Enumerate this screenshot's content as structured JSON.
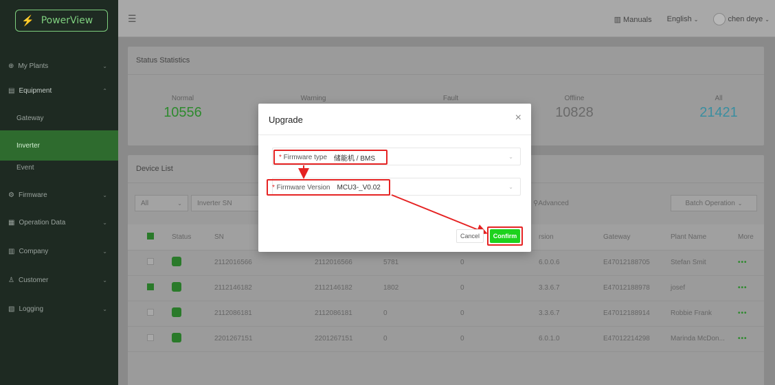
{
  "brand": {
    "logo_text": "PowerView"
  },
  "sidebar": {
    "items": [
      {
        "label": "My Plants",
        "icon": "globe-icon"
      },
      {
        "label": "Equipment",
        "icon": "equipment-icon"
      },
      {
        "label": "Gateway"
      },
      {
        "label": "Inverter",
        "active": true
      },
      {
        "label": "Event"
      },
      {
        "label": "Firmware",
        "icon": "gear-icon"
      },
      {
        "label": "Operation Data",
        "icon": "grid-icon"
      },
      {
        "label": "Company",
        "icon": "company-icon"
      },
      {
        "label": "Customer",
        "icon": "customer-icon"
      },
      {
        "label": "Logging",
        "icon": "log-icon"
      }
    ]
  },
  "header": {
    "manuals": "Manuals",
    "language": "English",
    "user": "chen deye"
  },
  "status": {
    "title": "Status Statistics",
    "items": [
      {
        "label": "Normal",
        "value": "10556",
        "color": "#2e8a2e"
      },
      {
        "label": "Warning",
        "value": ""
      },
      {
        "label": "Fault",
        "value": ""
      },
      {
        "label": "Offline",
        "value": "10828",
        "color": "#6a6a6a"
      },
      {
        "label": "All",
        "value": "21421",
        "color": "#3a8ea0"
      }
    ]
  },
  "device_list": {
    "title": "Device List",
    "filter_all": "All",
    "sn_placeholder": "Inverter SN",
    "advanced": "Advanced",
    "batch": "Batch Operation",
    "columns": [
      "Status",
      "SN",
      "",
      "",
      "",
      "rsion",
      "Gateway",
      "Plant Name",
      "More"
    ],
    "rows": [
      {
        "checked": false,
        "sn": "2112016566",
        "sn2": "2112016566",
        "c3": "5781",
        "c4": "0",
        "version": "6.0.0.6",
        "gateway": "E47012188705",
        "plant": "Stefan Smit"
      },
      {
        "checked": true,
        "sn": "2112146182",
        "sn2": "2112146182",
        "c3": "1802",
        "c4": "0",
        "version": "3.3.6.7",
        "gateway": "E47012188978",
        "plant": "josef"
      },
      {
        "checked": false,
        "sn": "2112086181",
        "sn2": "2112086181",
        "c3": "0",
        "c4": "0",
        "version": "3.3.6.7",
        "gateway": "E47012188914",
        "plant": "Robbie Frank"
      },
      {
        "checked": false,
        "sn": "2201267151",
        "sn2": "2201267151",
        "c3": "0",
        "c4": "0",
        "version": "6.0.1.0",
        "gateway": "E47012214298",
        "plant": "Marinda McDon..."
      }
    ]
  },
  "modal": {
    "title": "Upgrade",
    "firmware_type_label": "Firmware type",
    "firmware_type_value": "储能机 / BMS",
    "firmware_version_label": "Firmware Version",
    "firmware_version_value": "MCU3-_V0.02",
    "cancel": "Cancel",
    "confirm": "Confirm"
  },
  "colors": {
    "highlight": "#e52222",
    "confirm": "#1dd21d",
    "brand": "#7fd07f"
  }
}
